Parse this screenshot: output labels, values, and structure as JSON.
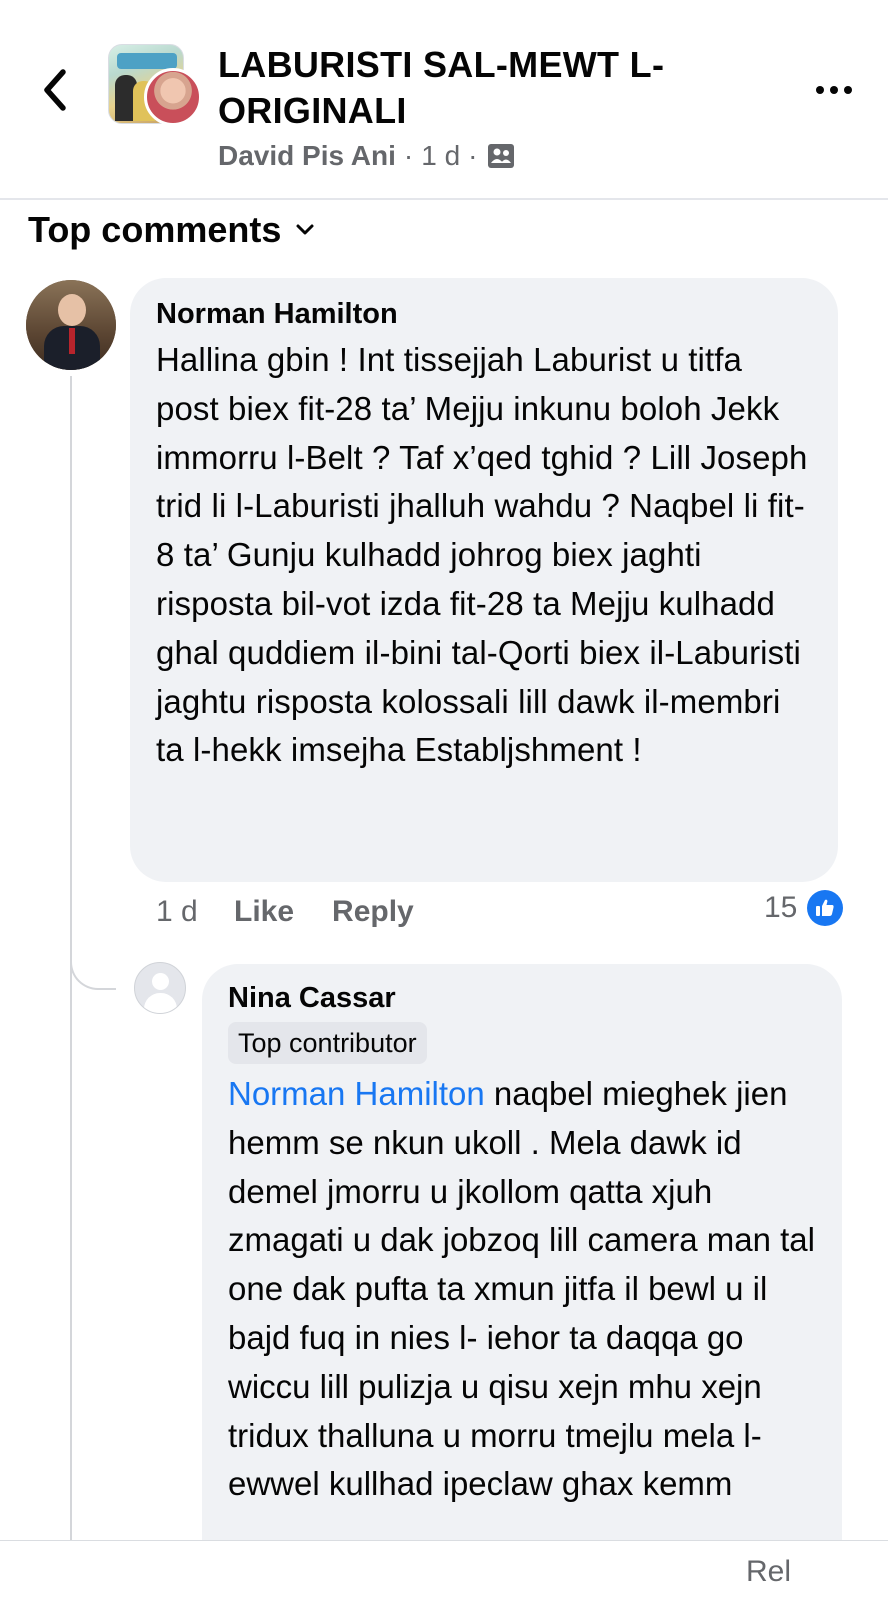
{
  "header": {
    "group_title": "LABURISTI SAL-MEWT L-ORIGINALI",
    "author": "David Pis Ani",
    "separator": "·",
    "time": "1 d",
    "privacy_icon": "group-members-icon"
  },
  "sort": {
    "label": "Top comments"
  },
  "comments": [
    {
      "author": "Norman Hamilton",
      "text": "Hallina gbin ! Int tissejjah Laburist u titfa post biex fit-28 ta’ Mejju inkunu boloh Jekk immorru l-Belt ? Taf x’qed tghid ? Lill Joseph trid li l-Laburisti jhalluh wahdu ? Naqbel li fit-8 ta’ Gunju kulhadd johrog biex jaghti risposta bil-vot izda fit-28 ta Mejju kulhadd ghal quddiem il-bini tal-Qorti biex il-Laburisti jaghtu risposta kolossali lill dawk il-membri ta l-hekk imsejha Establjshment !",
      "time": "1 d",
      "like_label": "Like",
      "reply_label": "Reply",
      "reaction_count": "15"
    },
    {
      "author": "Nina Cassar",
      "badge": "Top contributor",
      "mention": "Norman Hamilton",
      "text": " naqbel mieghek jien hemm se nkun ukoll . Mela dawk id demel jmorru u jkollom qatta xjuh zmagati u dak jobzoq lill camera man tal one dak pufta ta xmun jitfa il bewl u il bajd fuq in nies l- iehor ta daqqa go wiccu lill pulizja u qisu xejn mhu xejn tridux thalluna u morru tmejlu mela l-ewwel kullhad ipeclaw ghax kemm"
    }
  ],
  "bottom": {
    "hint": "Rel"
  },
  "colors": {
    "link": "#1877f2",
    "secondary_text": "#65676b",
    "bubble": "#f0f2f5"
  }
}
